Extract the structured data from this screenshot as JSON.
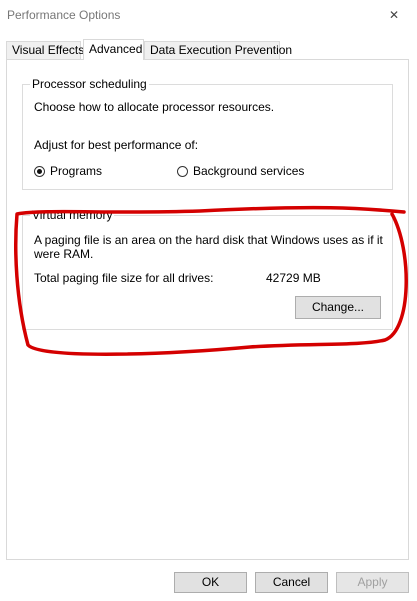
{
  "window": {
    "title": "Performance Options",
    "close_glyph": "✕"
  },
  "tabs": [
    {
      "label": "Visual Effects",
      "active": false
    },
    {
      "label": "Advanced",
      "active": true
    },
    {
      "label": "Data Execution Prevention",
      "active": false
    }
  ],
  "processor": {
    "legend": "Processor scheduling",
    "description": "Choose how to allocate processor resources.",
    "adjust_label": "Adjust for best performance of:",
    "options": [
      {
        "label": "Programs",
        "selected": true
      },
      {
        "label": "Background services",
        "selected": false
      }
    ]
  },
  "virtual_memory": {
    "legend": "Virtual memory",
    "description_line1": "A paging file is an area on the hard disk that Windows uses as if it",
    "description_line2": "were RAM.",
    "total_label": "Total paging file size for all drives:",
    "total_value": "42729 MB",
    "change_button": "Change..."
  },
  "footer": {
    "ok": "OK",
    "cancel": "Cancel",
    "apply": "Apply"
  },
  "colors": {
    "annotation": "#d40000"
  }
}
